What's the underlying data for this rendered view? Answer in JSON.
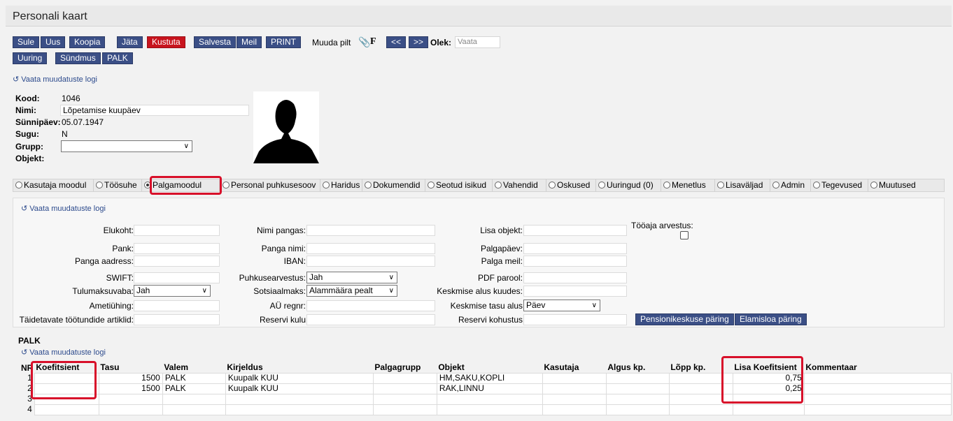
{
  "window": {
    "title": "Personali kaart"
  },
  "toolbar": {
    "sule": "Sule",
    "uus": "Uus",
    "koopia": "Koopia",
    "jata": "Jäta",
    "kustuta": "Kustuta",
    "salvesta": "Salvesta",
    "meil": "Meil",
    "print": "PRINT",
    "muuda_pilt": "Muuda pilt",
    "f_label": "F",
    "prev": "<<",
    "next": ">>",
    "olek_label": "Olek:",
    "olek_value": "Vaata",
    "uuring": "Uuring",
    "sundmus": "Sündmus",
    "palk": "PALK"
  },
  "log_link": "Vaata muudatuste logi",
  "employee": {
    "kood_label": "Kood:",
    "kood": "1046",
    "nimi_label": "Nimi:",
    "nimi": "Lõpetamise kuupäev",
    "synnipaev_label": "Sünnipäev:",
    "synnipaev": "05.07.1947",
    "sugu_label": "Sugu:",
    "sugu": "N",
    "grupp_label": "Grupp:",
    "grupp": "",
    "objekt_label": "Objekt:"
  },
  "tabs": [
    {
      "label": "Kasutaja moodul",
      "selected": false
    },
    {
      "label": "Töösuhe",
      "selected": false
    },
    {
      "label": "Palgamoodul",
      "selected": true
    },
    {
      "label": "Personal puhkusesoov",
      "selected": false
    },
    {
      "label": "Haridus",
      "selected": false
    },
    {
      "label": "Dokumendid",
      "selected": false
    },
    {
      "label": "Seotud isikud",
      "selected": false
    },
    {
      "label": "Vahendid",
      "selected": false
    },
    {
      "label": "Oskused",
      "selected": false
    },
    {
      "label": "Uuringud (0)",
      "selected": false
    },
    {
      "label": "Menetlus",
      "selected": false
    },
    {
      "label": "Lisaväljad",
      "selected": false
    },
    {
      "label": "Admin",
      "selected": false
    },
    {
      "label": "Tegevused",
      "selected": false
    },
    {
      "label": "Muutused",
      "selected": false
    }
  ],
  "form": {
    "elukoht": "Elukoht:",
    "pank": "Pank:",
    "panga_aadress": "Panga aadress:",
    "swift": "SWIFT:",
    "tulumaksuvaba": "Tulumaksuvaba:",
    "tulumaksuvaba_value": "Jah",
    "ametiuhing": "Ametiühing:",
    "taidetavate": "Täidetavate töötundide artiklid:",
    "nimi_pangas": "Nimi pangas:",
    "panga_nimi": "Panga nimi:",
    "iban": "IBAN:",
    "puhkusearvestus": "Puhkusearvestus:",
    "puhkusearvestus_value": "Jah",
    "sotsiaalmaks": "Sotsiaalmaks:",
    "sotsiaalmaks_value": "Alammäära pealt",
    "au_regnr": "AÜ regnr:",
    "reservi_kulu": "Reservi kulu",
    "lisa_objekt": "Lisa objekt:",
    "palgapaev": "Palgapäev:",
    "palga_meil": "Palga meil:",
    "pdf_parool": "PDF parool:",
    "keskmise_alus": "Keskmise alus kuudes:",
    "keskmise_tasu": "Keskmise tasu alus",
    "keskmise_tasu_value": "Päev",
    "reservi_kohustus": "Reservi kohustus",
    "tooaja_arvestus": "Tööaja arvestus:",
    "pension_button": "Pensionikeskuse päring",
    "elamisloa_button": "Elamisloa päring"
  },
  "palk": {
    "section_title": "PALK",
    "columns": [
      "NR",
      "Koefitsient",
      "Tasu",
      "Valem",
      "Kirjeldus",
      "Palgagrupp",
      "Objekt",
      "Kasutaja",
      "Algus kp.",
      "Lõpp kp.",
      "Lisa Koefitsient",
      "Kommentaar"
    ],
    "rows": [
      [
        "1",
        "",
        "1500",
        "PALK",
        "Kuupalk KUU",
        "",
        "HM,SAKU,KOPLI",
        "",
        "",
        "",
        "0,75",
        ""
      ],
      [
        "2",
        "",
        "1500",
        "PALK",
        "Kuupalk KUU",
        "",
        "RAK,LINNU",
        "",
        "",
        "",
        "0,25",
        ""
      ],
      [
        "3",
        "",
        "",
        "",
        "",
        "",
        "",
        "",
        "",
        "",
        "",
        ""
      ],
      [
        "4",
        "",
        "",
        "",
        "",
        "",
        "",
        "",
        "",
        "",
        "",
        ""
      ]
    ]
  },
  "colors": {
    "button": "#3b4f86",
    "danger": "#c8141e",
    "highlight": "#d8102a",
    "link": "#2c4a8c"
  }
}
